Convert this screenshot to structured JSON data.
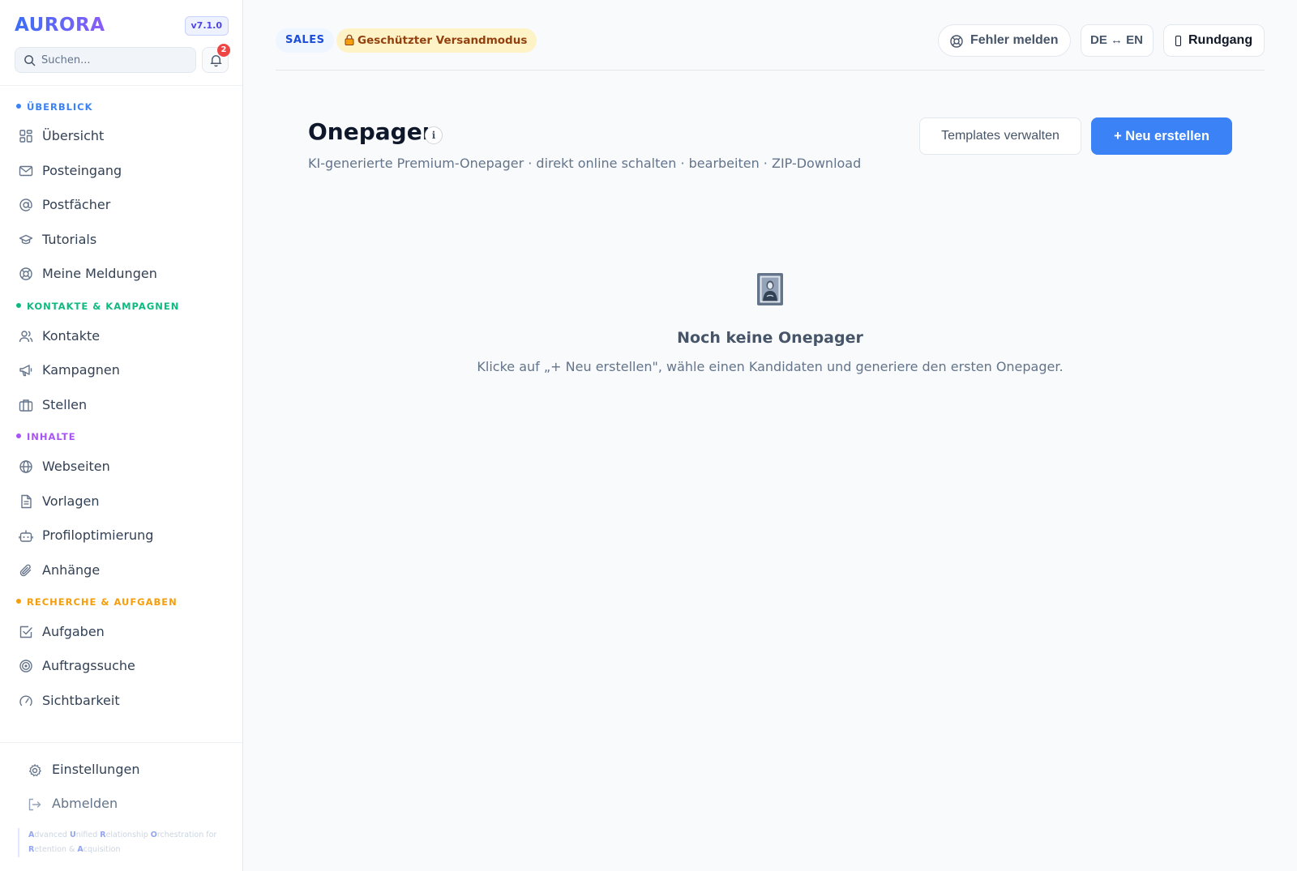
{
  "app": {
    "brand": "AURORA",
    "version": "v7.1.0"
  },
  "search": {
    "placeholder": "Suchen..."
  },
  "notifications": {
    "count": "2"
  },
  "colors": {
    "primary": "#3b82f6",
    "section_overview": "#3b82f6",
    "section_contacts": "#10b981",
    "section_content": "#a855f7",
    "section_research": "#f59e0b",
    "badge": "#ef4444",
    "mode_pill_bg": "#fef3c7"
  },
  "sidebar": {
    "sections": [
      {
        "title": "ÜBERBLICK",
        "items": [
          {
            "label": "Übersicht",
            "icon": "grid-icon"
          },
          {
            "label": "Posteingang",
            "icon": "mail-icon"
          },
          {
            "label": "Postfächer",
            "icon": "at-sign-icon"
          },
          {
            "label": "Tutorials",
            "icon": "graduation-cap-icon"
          },
          {
            "label": "Meine Meldungen",
            "icon": "lifebuoy-icon"
          }
        ]
      },
      {
        "title": "KONTAKTE & KAMPAGNEN",
        "items": [
          {
            "label": "Kontakte",
            "icon": "users-icon"
          },
          {
            "label": "Kampagnen",
            "icon": "megaphone-icon"
          },
          {
            "label": "Stellen",
            "icon": "briefcase-icon"
          }
        ]
      },
      {
        "title": "INHALTE",
        "items": [
          {
            "label": "Webseiten",
            "icon": "globe-icon"
          },
          {
            "label": "Vorlagen",
            "icon": "file-text-icon"
          },
          {
            "label": "Profiloptimierung",
            "icon": "bot-icon"
          },
          {
            "label": "Anhänge",
            "icon": "paperclip-icon"
          }
        ]
      },
      {
        "title": "RECHERCHE & AUFGABEN",
        "items": [
          {
            "label": "Aufgaben",
            "icon": "check-square-icon"
          },
          {
            "label": "Auftragssuche",
            "icon": "target-icon"
          },
          {
            "label": "Sichtbarkeit",
            "icon": "gauge-icon"
          }
        ]
      }
    ],
    "bottom": {
      "settings": "Einstellungen",
      "logout": "Abmelden"
    },
    "acronym": [
      {
        "initial": "A",
        "rest": "dvanced "
      },
      {
        "initial": "U",
        "rest": "nified "
      },
      {
        "initial": "R",
        "rest": "elationship "
      },
      {
        "initial": "O",
        "rest": "rchestration for "
      },
      {
        "initial": "R",
        "rest": "etention & "
      },
      {
        "initial": "A",
        "rest": "cquisition"
      }
    ]
  },
  "header": {
    "role_badge": "SALES",
    "mode_badge": "Geschützter Versandmodus",
    "report_button": "Fehler melden",
    "lang_toggle": "DE ↔ EN",
    "tour_button": "Rundgang"
  },
  "main": {
    "title": "Onepager",
    "info": "i",
    "subtitle": "KI-generierte Premium-Onepager · direkt online schalten · bearbeiten · ZIP-Download",
    "templates_button": "Templates verwalten",
    "new_button": "+ Neu erstellen",
    "empty": {
      "icon": "framed-picture-icon",
      "title": "Noch keine Onepager",
      "text": "Klicke auf „+ Neu erstellen\", wähle einen Kandidaten und generiere den ersten Onepager."
    }
  }
}
